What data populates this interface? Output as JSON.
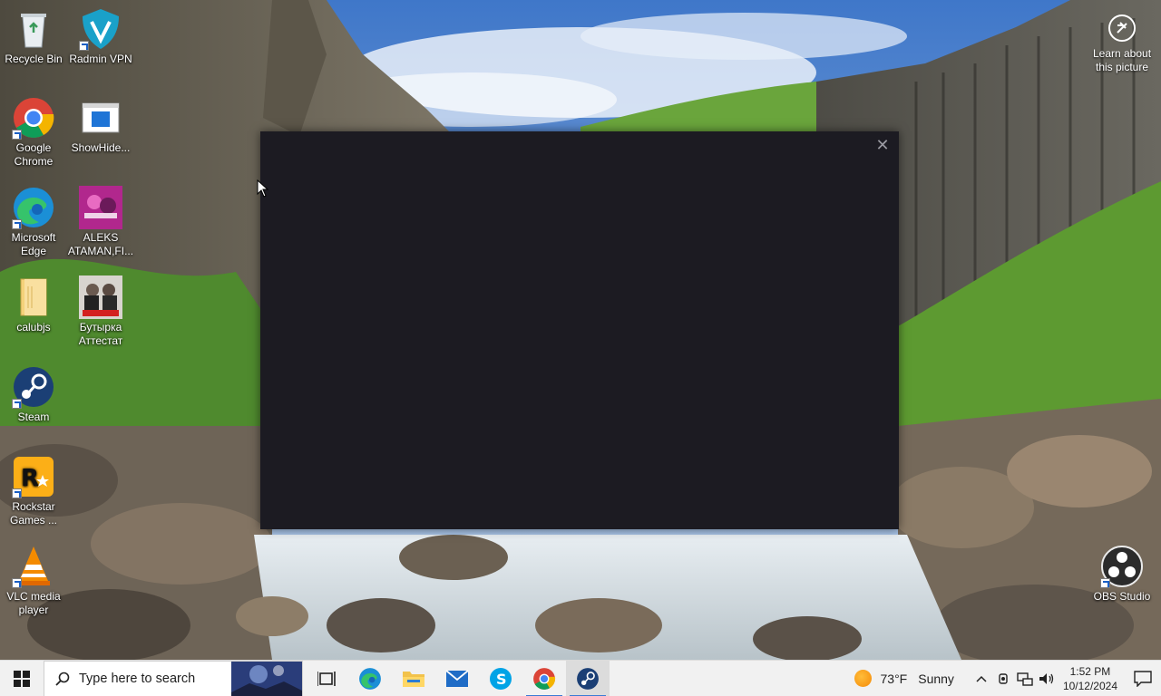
{
  "desktop": {
    "icons": [
      {
        "label": "Recycle Bin",
        "icon": "recycle-bin-icon"
      },
      {
        "label": "Radmin VPN",
        "icon": "radmin-vpn-icon"
      },
      {
        "label": "Google Chrome",
        "icon": "chrome-icon"
      },
      {
        "label": "ShowHide...",
        "icon": "showhide-icon"
      },
      {
        "label": "Microsoft Edge",
        "icon": "edge-icon"
      },
      {
        "label": "ALEKS ATAMAN,FI...",
        "icon": "album-art-icon"
      },
      {
        "label": "calubjs",
        "icon": "folder-icon"
      },
      {
        "label": "Бутырка Аттестат",
        "icon": "album-art-icon"
      },
      {
        "label": "Steam",
        "icon": "steam-icon"
      },
      {
        "label": "Rockstar Games ...",
        "icon": "rockstar-icon"
      },
      {
        "label": "VLC media player",
        "icon": "vlc-icon"
      },
      {
        "label": "OBS Studio",
        "icon": "obs-icon"
      }
    ],
    "learn_about": "Learn about this picture"
  },
  "window": {
    "close_glyph": "✕"
  },
  "taskbar": {
    "search_placeholder": "Type here to search",
    "apps": [
      "task-view",
      "edge",
      "file-explorer",
      "mail",
      "skype",
      "chrome",
      "steam"
    ],
    "weather": {
      "temp": "73°F",
      "condition": "Sunny"
    },
    "clock": {
      "time": "1:52 PM",
      "date": "10/12/2024"
    },
    "accent": "#3a7bd5"
  }
}
